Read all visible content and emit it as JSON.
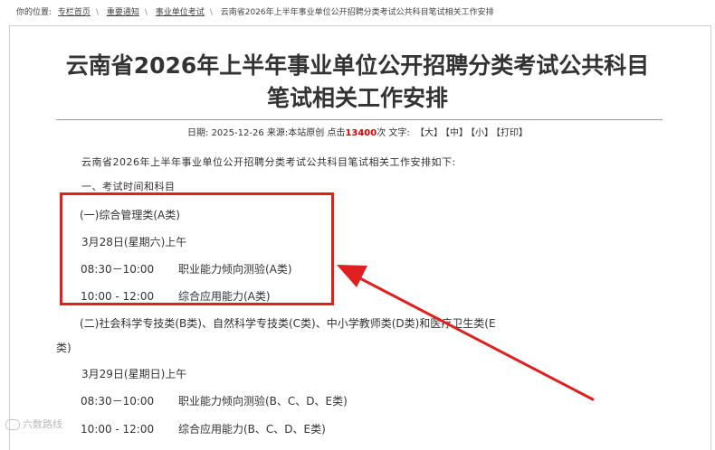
{
  "breadcrumb": {
    "prefix": "你的位置:",
    "items": [
      "专栏首页",
      "重要通知",
      "事业单位考试",
      "云南省2026年上半年事业单位公开招聘分类考试公共科目笔试相关工作安排"
    ]
  },
  "article": {
    "title_line1": "云南省2026年上半年事业单位公开招聘分类考试公共科目",
    "title_line2": "笔试相关工作安排",
    "meta": {
      "date_label": "日期:",
      "date": "2025-12-26",
      "source_label": "来源:",
      "source": "本站原创",
      "hits_label": "点击",
      "hits": "13400",
      "hits_unit": "次",
      "text_size_label": "文字:",
      "size_large": "【大】",
      "size_medium": "【中】",
      "size_small": "【小】",
      "print": "【打印】"
    },
    "intro": "云南省2026年上半年事业单位公开招聘分类考试公共科目笔试相关工作安排如下:",
    "section1_heading": "一、考试时间和科目",
    "category_a": {
      "heading": "(一)综合管理类(A类)",
      "date": "3月28日(星期六)上午",
      "rows": [
        {
          "time": "08:30－10:00",
          "subject": "职业能力倾向测验(A类)"
        },
        {
          "time": "10:00 - 12:00",
          "subject": "综合应用能力(A类)"
        }
      ]
    },
    "category_bcde": {
      "heading_line1": "(二)社会科学专技类(B类)、自然科学专技类(C类)、中小学教师类(D类)和医疗卫生类(E",
      "heading_line2": "类)",
      "date": "3月29日(星期日)上午",
      "rows": [
        {
          "time": "08:30－10:00",
          "subject": "职业能力倾向测验(B、C、D、E类)"
        },
        {
          "time": "10:00 - 12:00",
          "subject": "综合应用能力(B、C、D、E类)"
        }
      ]
    }
  },
  "watermark": "六数路线",
  "colors": {
    "highlight_box": "#e02020",
    "hits_count": "#dd0000"
  }
}
